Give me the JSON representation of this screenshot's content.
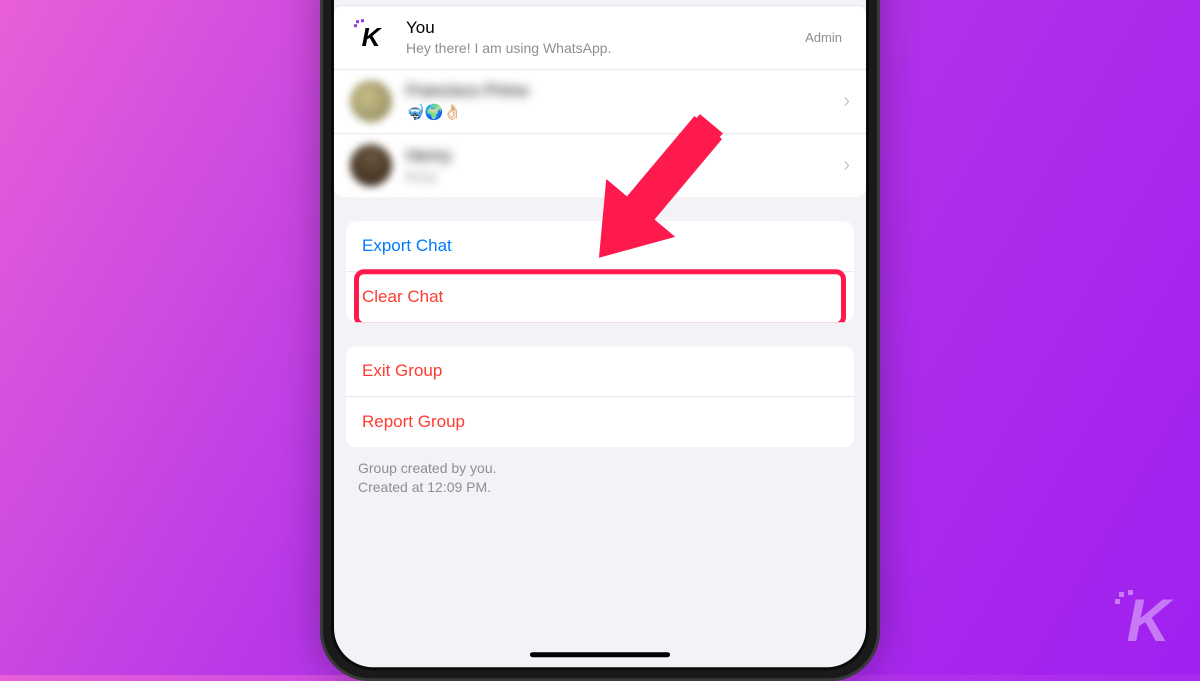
{
  "participants": {
    "you": {
      "name": "You",
      "status": "Hey there! I am using WhatsApp.",
      "badge": "Admin"
    },
    "member2": {
      "name": "Francisco Primo",
      "status": "🤿🌍👌🏻"
    },
    "member3": {
      "name": "Henry",
      "status": "Busy"
    }
  },
  "actions": {
    "export": "Export Chat",
    "clear": "Clear Chat",
    "exit": "Exit Group",
    "report": "Report Group"
  },
  "footer": {
    "line1": "Group created by you.",
    "line2": "Created at 12:09 PM."
  },
  "watermark": "K"
}
